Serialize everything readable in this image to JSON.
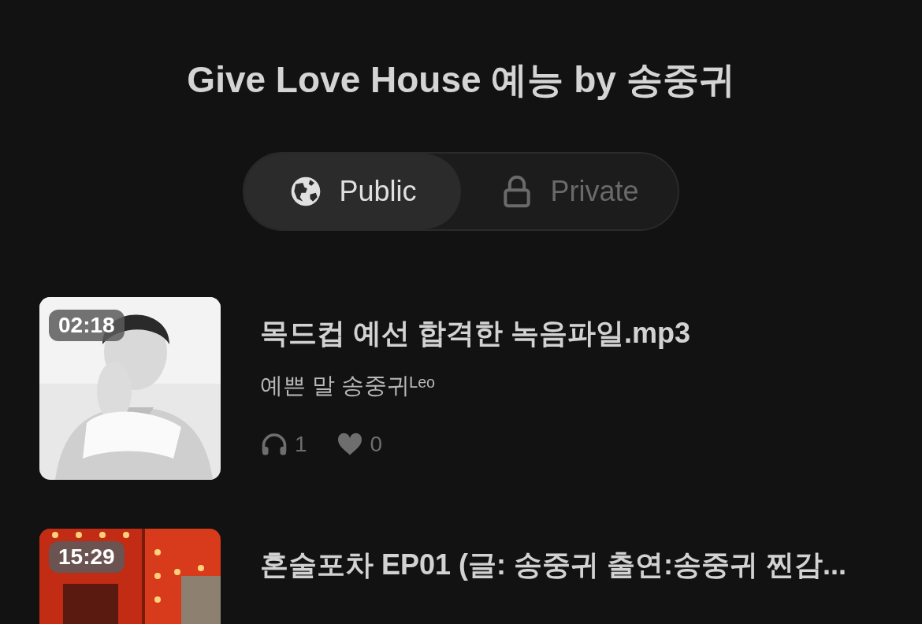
{
  "title": "Give Love House 예능 by 송중귀",
  "tabs": [
    {
      "label": "Public",
      "selected": true
    },
    {
      "label": "Private",
      "selected": false
    }
  ],
  "episodes": [
    {
      "duration": "02:18",
      "title": "목드컵 예선 합격한 녹음파일.mp3",
      "author": "예쁜 말 송중귀ᴸᵉᵒ",
      "listens": "1",
      "likes": "0"
    },
    {
      "duration": "15:29",
      "title": "혼술포차 EP01 (글: 송중귀 출연:송중귀 찐감..."
    }
  ]
}
